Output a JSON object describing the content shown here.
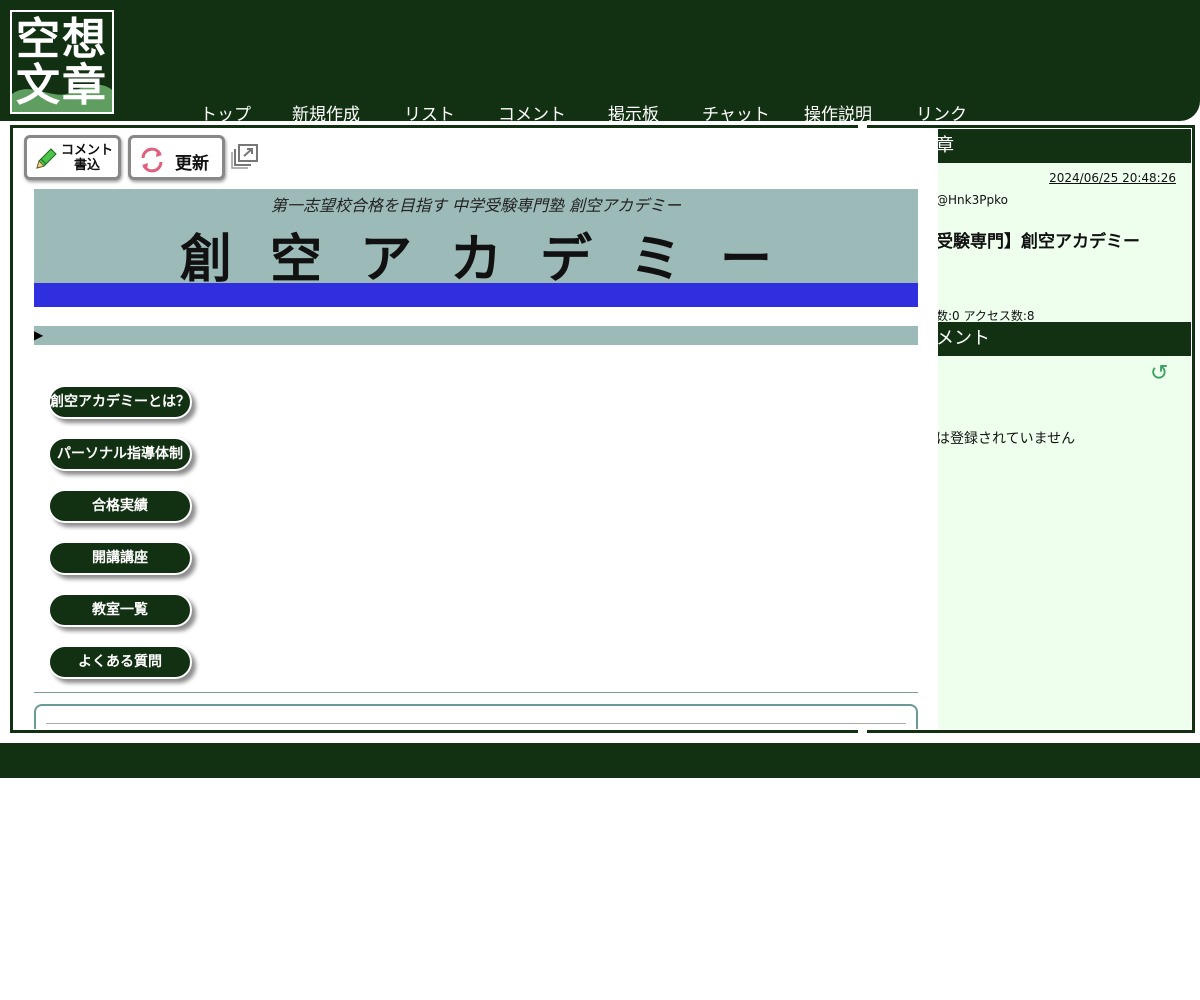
{
  "header": {
    "logo_chars": [
      "空",
      "想",
      "文",
      "章"
    ],
    "nav": [
      "トップ",
      "新規作成",
      "リスト",
      "コメント",
      "掲示板",
      "チャット",
      "操作説明",
      "リンク"
    ]
  },
  "toolbar": {
    "comment_label_1": "コメント",
    "comment_label_2": "書込",
    "update_label": "更新"
  },
  "banner": {
    "subtitle": "第一志望校合格を目指す 中学受験専門塾 創空アカデミー",
    "title": "創空アカデミー"
  },
  "subbar": {
    "arrow": "▶"
  },
  "menu": [
    "創空アカデミーとは？",
    "パーソナル指導体制",
    "合格実績",
    "開講講座",
    "教室一覧",
    "よくある質問"
  ],
  "right": {
    "header1": "章",
    "date": "2024/06/25 20:48:26",
    "user": "@Hnk3Ppko",
    "title": "受験専門】創空アカデミー",
    "stats": "数:0 アクセス数:8",
    "header2": "メント",
    "reload": "↺",
    "empty": "は登録されていません"
  },
  "colors": {
    "brand": "#123012",
    "banner_bg": "#9cbab8",
    "banner_bar": "#2f2fe0",
    "panel_bg": "#eeffee"
  }
}
